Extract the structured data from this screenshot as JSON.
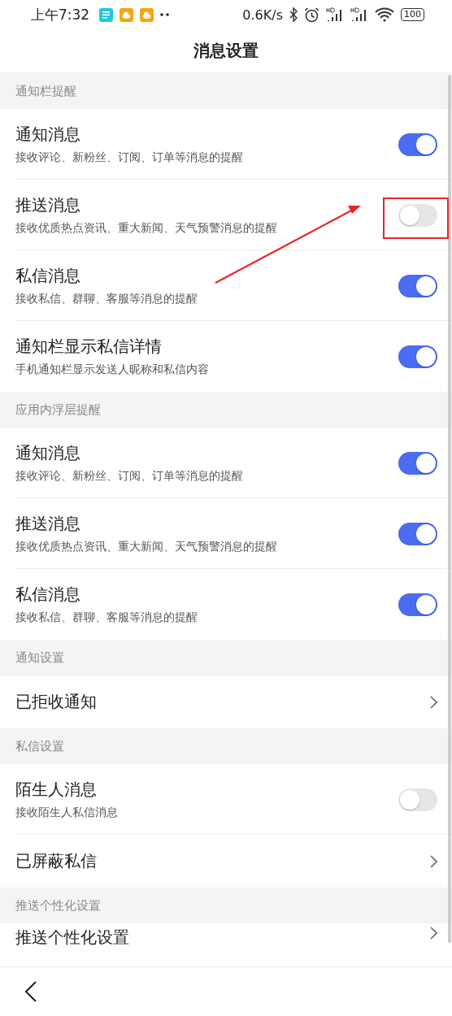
{
  "status_bar": {
    "time": "上午7:32",
    "speed": "0.6K/s",
    "battery": "100"
  },
  "title": "消息设置",
  "sections": [
    {
      "header": "通知栏提醒",
      "rows": [
        {
          "kind": "toggle",
          "title": "通知消息",
          "subtitle": "接收评论、新粉丝、订阅、订单等消息的提醒",
          "on": true
        },
        {
          "kind": "toggle",
          "title": "推送消息",
          "subtitle": "接收优质热点资讯、重大新闻、天气预警消息的提醒",
          "on": false
        },
        {
          "kind": "toggle",
          "title": "私信消息",
          "subtitle": "接收私信、群聊、客服等消息的提醒",
          "on": true
        },
        {
          "kind": "toggle",
          "title": "通知栏显示私信详情",
          "subtitle": "手机通知栏显示发送人昵称和私信内容",
          "on": true
        }
      ]
    },
    {
      "header": "应用内浮层提醒",
      "rows": [
        {
          "kind": "toggle",
          "title": "通知消息",
          "subtitle": "接收评论、新粉丝、订阅、订单等消息的提醒",
          "on": true
        },
        {
          "kind": "toggle",
          "title": "推送消息",
          "subtitle": "接收优质热点资讯、重大新闻、天气预警消息的提醒",
          "on": true
        },
        {
          "kind": "toggle",
          "title": "私信消息",
          "subtitle": "接收私信、群聊、客服等消息的提醒",
          "on": true
        }
      ]
    },
    {
      "header": "通知设置",
      "rows": [
        {
          "kind": "link",
          "title": "已拒收通知"
        }
      ]
    },
    {
      "header": "私信设置",
      "rows": [
        {
          "kind": "toggle",
          "title": "陌生人消息",
          "subtitle": "接收陌生人私信消息",
          "on": false
        },
        {
          "kind": "link",
          "title": "已屏蔽私信"
        }
      ]
    },
    {
      "header": "推送个性化设置",
      "rows": [
        {
          "kind": "link",
          "title": "推送个性化设置"
        }
      ]
    }
  ]
}
